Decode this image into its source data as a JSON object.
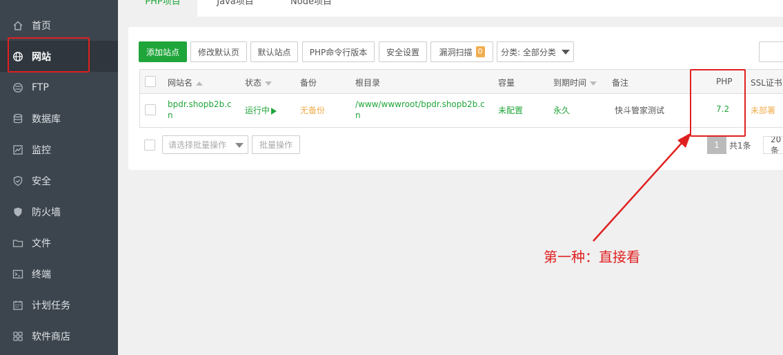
{
  "sidebar": {
    "items": [
      {
        "label": "首页",
        "icon": "home-icon"
      },
      {
        "label": "网站",
        "icon": "globe-icon",
        "active": true
      },
      {
        "label": "FTP",
        "icon": "ftp-icon"
      },
      {
        "label": "数据库",
        "icon": "database-icon"
      },
      {
        "label": "监控",
        "icon": "monitor-icon"
      },
      {
        "label": "安全",
        "icon": "shield-icon"
      },
      {
        "label": "防火墙",
        "icon": "firewall-icon"
      },
      {
        "label": "文件",
        "icon": "folder-icon"
      },
      {
        "label": "终端",
        "icon": "terminal-icon"
      },
      {
        "label": "计划任务",
        "icon": "calendar-icon"
      },
      {
        "label": "软件商店",
        "icon": "apps-icon"
      }
    ]
  },
  "tabs": [
    {
      "label": "PHP项目",
      "active": true
    },
    {
      "label": "Java项目"
    },
    {
      "label": "Node项目"
    }
  ],
  "toolbar": {
    "add_site": "添加站点",
    "edit_default_page": "修改默认页",
    "default_site": "默认站点",
    "php_cli_version": "PHP命令行版本",
    "security_settings": "安全设置",
    "vuln_scan": "漏洞扫描",
    "vuln_count": "0",
    "category_select": "分类: 全部分类"
  },
  "table": {
    "headers": {
      "site_name": "网站名",
      "status": "状态",
      "backup": "备份",
      "root_dir": "根目录",
      "capacity": "容量",
      "expiry": "到期时间",
      "remark": "备注",
      "php": "PHP",
      "ssl": "SSL证书"
    },
    "rows": [
      {
        "site_name_line1": "bpdr.shopb2b.c",
        "site_name_line2": "n",
        "status": "运行中",
        "backup": "无备份",
        "root_dir_line1": "/www/wwwroot/bpdr.shopb2b.c",
        "root_dir_line2": "n",
        "capacity": "未配置",
        "expiry": "永久",
        "remark": "快斗管家测试",
        "php": "7.2",
        "ssl": "未部署"
      }
    ]
  },
  "batch": {
    "placeholder": "请选择批量操作",
    "button": "批量操作"
  },
  "pagination": {
    "current_page": "1",
    "total": "共1条",
    "per_page": "20条"
  },
  "annotation": {
    "text": "第一种：直接看",
    "color": "#e02020"
  },
  "colors": {
    "accent_green": "#20a53a",
    "warning_orange": "#f0ad4e",
    "sidebar_bg": "#3c444d"
  }
}
